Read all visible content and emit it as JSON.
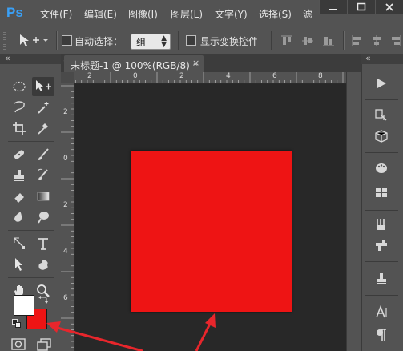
{
  "app": {
    "logo": "Ps",
    "menu": [
      "文件(F)",
      "编辑(E)",
      "图像(I)",
      "图层(L)",
      "文字(Y)",
      "选择(S)",
      "滤"
    ]
  },
  "window_controls": {
    "minimize_icon": "minimize-icon",
    "maximize_icon": "maximize-icon",
    "close_icon": "close-icon"
  },
  "options_bar": {
    "auto_select_label": "自动选择：",
    "auto_select_checked": false,
    "auto_select_target": "组",
    "show_transform_label": "显示变换控件",
    "show_transform_checked": false
  },
  "collapse_glyph": "«",
  "document": {
    "tab_title": "未标题-1 @ 100%(RGB/8) *",
    "close_glyph": "×",
    "canvas_color": "#ee1414"
  },
  "rulers": {
    "top": [
      "2",
      "0",
      "2",
      "4",
      "6",
      "8"
    ],
    "left": [
      "2",
      "0",
      "2",
      "4",
      "6"
    ]
  },
  "colors": {
    "foreground": "#ffffff",
    "background": "#ee1414",
    "annotation_arrow": "#e8262c"
  },
  "tools": [
    "marquee-tool-icon",
    "move-tool-icon",
    "lasso-tool-icon",
    "magic-wand-icon",
    "crop-tool-icon",
    "eyedropper-icon",
    "healing-brush-icon",
    "brush-tool-icon",
    "clone-stamp-icon",
    "history-brush-icon",
    "eraser-icon",
    "gradient-icon",
    "blur-tool-icon",
    "dodge-tool-icon",
    "pen-tool-icon",
    "type-tool-icon",
    "path-select-icon",
    "custom-shape-icon",
    "hand-tool-icon",
    "zoom-tool-icon"
  ],
  "right_panel": [
    "play-icon",
    "history-icon",
    "3d-icon",
    "swatches-icon",
    "adjustments-icon",
    "brushes-icon",
    "clone-source-icon",
    "stamp-icon",
    "character-icon",
    "paragraph-icon"
  ]
}
